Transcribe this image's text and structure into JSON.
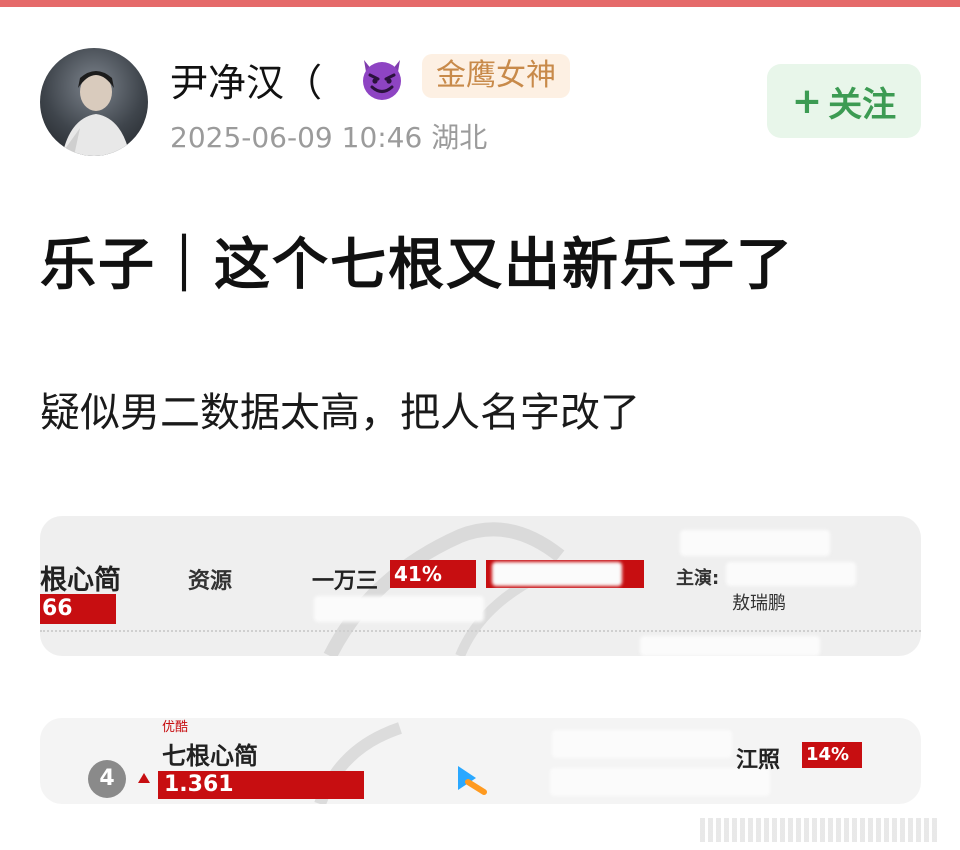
{
  "post": {
    "author": "尹净汉（",
    "badge": "金鹰女神",
    "timestamp": "2025-06-09 10:46",
    "location": "湖北",
    "follow_label": "关注",
    "follow_prefix": "+",
    "title": "乐子｜这个七根又出新乐子了",
    "body": "疑似男二数据太高，把人名字改了"
  },
  "screenshot1": {
    "show_title": "根心简",
    "category": "资源",
    "level": "一万三",
    "percent": "41%",
    "score": "66",
    "cast_label": "主演:",
    "cast_name": "敖瑞鹏"
  },
  "screenshot2": {
    "platform": "优酷",
    "rank": "4",
    "show_title": "七根心简",
    "value": "1.361",
    "actor": "江照",
    "percent": "14%"
  },
  "colors": {
    "accent_red": "#c70e11",
    "follow_green": "#3c9b53",
    "badge_gold": "#c88a4a"
  }
}
